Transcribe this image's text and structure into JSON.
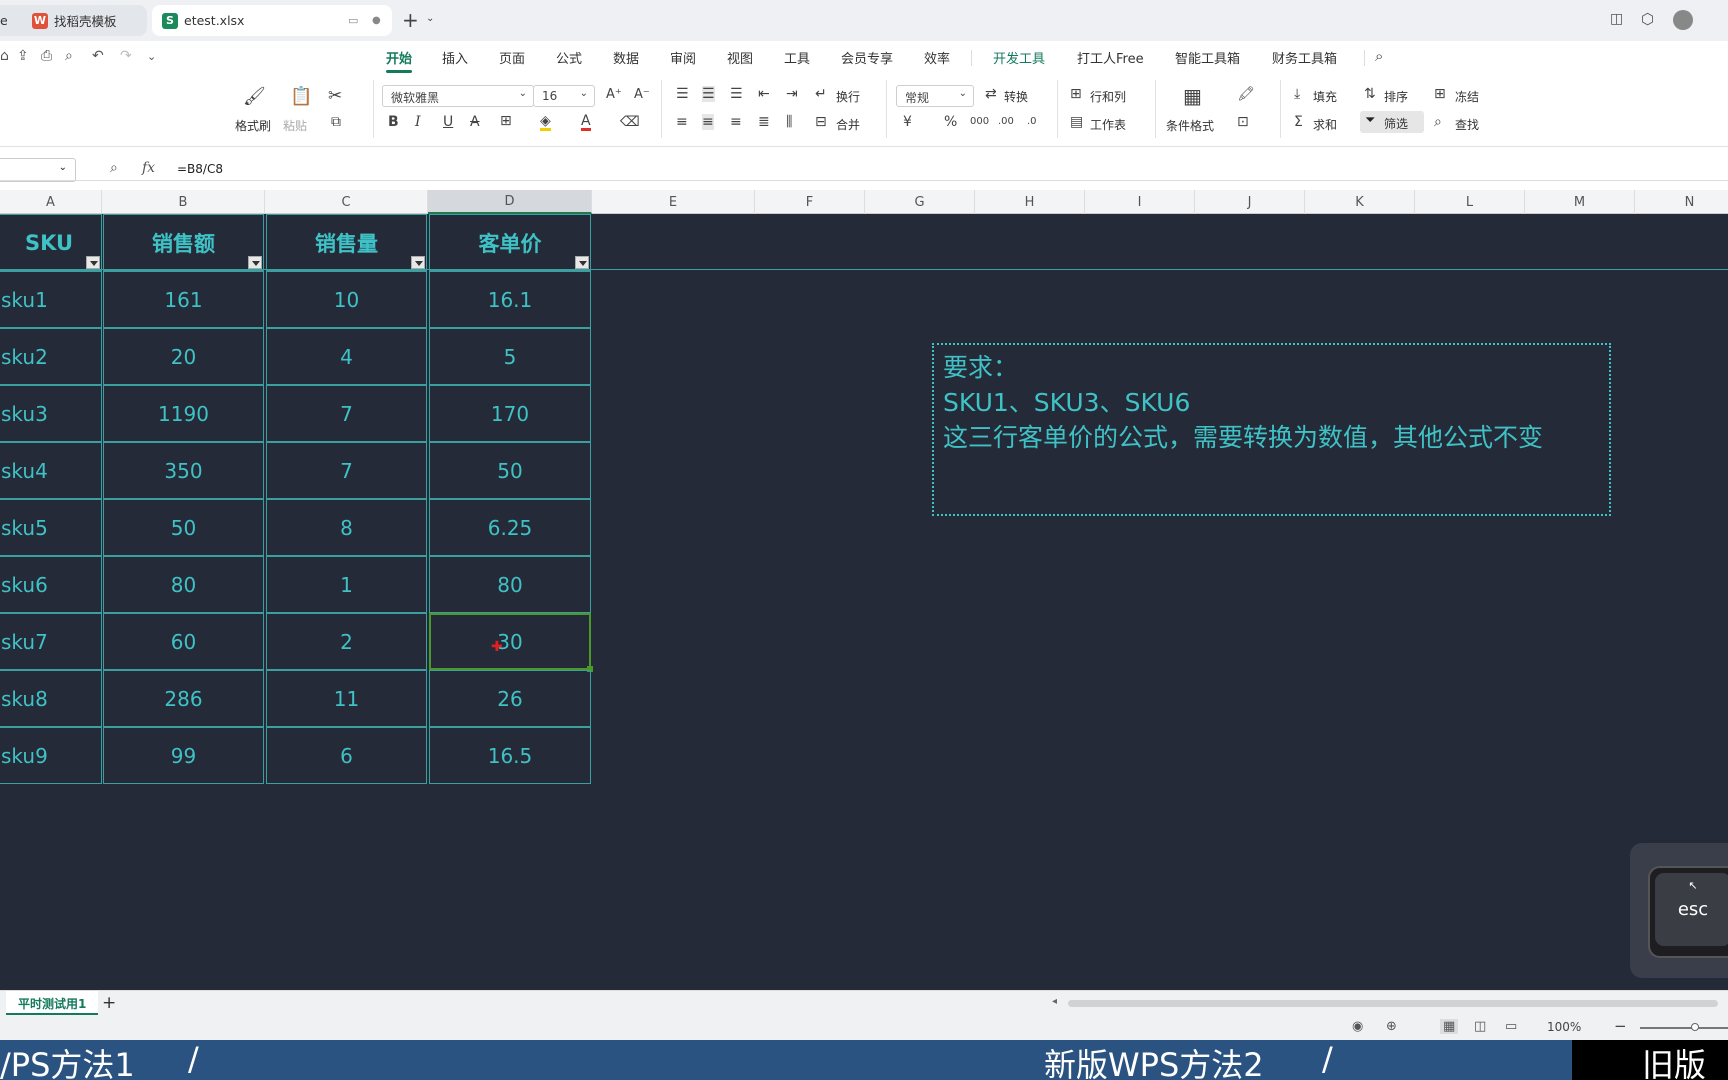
{
  "tabs": [
    {
      "label": "e",
      "icon": ""
    },
    {
      "label": "找稻壳模板",
      "icon": "docer-icon"
    },
    {
      "label": "etest.xlsx",
      "icon": "sheet-icon"
    }
  ],
  "menu": [
    "开始",
    "插入",
    "页面",
    "公式",
    "数据",
    "审阅",
    "视图",
    "工具",
    "会员专享",
    "效率",
    "开发工具",
    "打工人Free",
    "智能工具箱",
    "财务工具箱"
  ],
  "ribbon": {
    "format_painter": "格式刷",
    "paste": "粘贴",
    "font_name": "微软雅黑",
    "font_size": "16",
    "wrap": "换行",
    "merge": "合并",
    "number_format": "常规",
    "convert": "转换",
    "row_col": "行和列",
    "worksheet": "工作表",
    "cond_format": "条件格式",
    "fill": "填充",
    "sort": "排序",
    "freeze": "冻结",
    "sum": "求和",
    "filter": "筛选",
    "find": "查找"
  },
  "formula_bar": {
    "fx": "fx",
    "formula": "=B8/C8"
  },
  "columns": [
    "A",
    "B",
    "C",
    "D",
    "E",
    "F",
    "G",
    "H",
    "I",
    "J",
    "K",
    "L",
    "M",
    "N"
  ],
  "table": {
    "headers": [
      "SKU",
      "销售额",
      "销售量",
      "客单价"
    ],
    "rows": [
      [
        "sku1",
        "161",
        "10",
        "16.1"
      ],
      [
        "sku2",
        "20",
        "4",
        "5"
      ],
      [
        "sku3",
        "1190",
        "7",
        "170"
      ],
      [
        "sku4",
        "350",
        "7",
        "50"
      ],
      [
        "sku5",
        "50",
        "8",
        "6.25"
      ],
      [
        "sku6",
        "80",
        "1",
        "80"
      ],
      [
        "sku7",
        "60",
        "2",
        "30"
      ],
      [
        "sku8",
        "286",
        "11",
        "26"
      ],
      [
        "sku9",
        "99",
        "6",
        "16.5"
      ]
    ]
  },
  "note": {
    "line1": "要求：",
    "line2": "SKU1、SKU3、SKU6",
    "line3": "这三行客单价的公式，需要转换为数值，其他公式不变"
  },
  "keyboard": {
    "esc": "esc"
  },
  "sheet_tab": "平时测试用1",
  "zoom": "100%",
  "caption": {
    "left": "/PS方法1",
    "slash1": "/",
    "mid": "新版WPS方法2",
    "slash2": "/",
    "right": "旧版W"
  },
  "colors": {
    "accent": "#147a5c",
    "sheet_bg": "#252a38",
    "cell_text": "#3fc2c6",
    "caption_bg": "#2b5382"
  }
}
